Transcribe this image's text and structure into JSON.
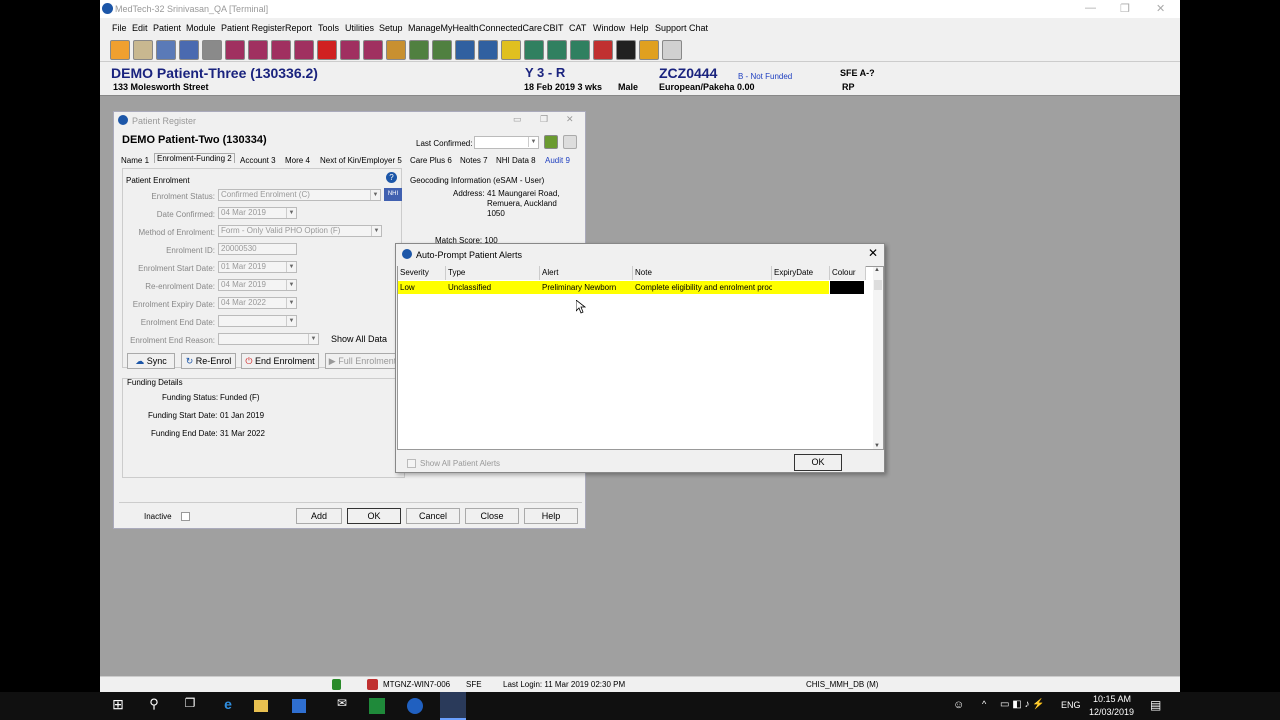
{
  "app": {
    "title": "MedTech-32  Srinivasan_QA  [Terminal]",
    "menu": [
      "File",
      "Edit",
      "Patient",
      "Module",
      "Patient Register",
      "Report",
      "Tools",
      "Utilities",
      "Setup",
      "ManageMyHealth",
      "ConnectedCare",
      "CBIT",
      "CAT",
      "Window",
      "Help",
      "Support Chat"
    ]
  },
  "banner": {
    "patient_name": "DEMO Patient-Three (130336.2)",
    "address": "133 Molesworth Street",
    "age": "Y 3 - R",
    "dob": "18 Feb 2019 3 wks",
    "gender": "Male",
    "nhi": "ZCZ0444",
    "funding": "B - Not Funded",
    "ethnicity": "European/Pakeha 0.00",
    "sfe": "SFE A-?",
    "rp": "RP"
  },
  "patient_register": {
    "title": "Patient Register",
    "patient": "DEMO Patient-Two (130334)",
    "last_confirmed_label": "Last Confirmed:",
    "tabs": [
      "Name 1",
      "Enrolment-Funding 2",
      "Account 3",
      "More 4",
      "Next of Kin/Employer 5",
      "Care Plus 6",
      "Notes 7",
      "NHI Data 8",
      "Audit 9"
    ],
    "enrolment_group": "Patient Enrolment",
    "fields": [
      {
        "label": "Enrolment Status:",
        "value": "Confirmed Enrolment (C)"
      },
      {
        "label": "Date Confirmed:",
        "value": "04 Mar 2019"
      },
      {
        "label": "Method of Enrolment:",
        "value": "Form - Only Valid PHO Option (F)"
      },
      {
        "label": "Enrolment ID:",
        "value": "20000530"
      },
      {
        "label": "Enrolment Start Date:",
        "value": "01 Mar 2019"
      },
      {
        "label": "Re-enrolment Date:",
        "value": "04 Mar 2019"
      },
      {
        "label": "Enrolment Expiry Date:",
        "value": "04 Mar 2022"
      },
      {
        "label": "Enrolment End Date:",
        "value": ""
      },
      {
        "label": "Enrolment End Reason:",
        "value": ""
      }
    ],
    "nhi_button": "NHI",
    "show_all_data": "Show All Data",
    "geocoding_title": "Geocoding Information (eSAM - User)",
    "address_label": "Address:",
    "address_lines": [
      "41 Maungarei Road,",
      "Remuera, Auckland",
      "1050"
    ],
    "match_score": "Match Score: 100",
    "action_buttons": {
      "sync": "Sync",
      "reenrol": "Re-Enrol",
      "end": "End Enrolment",
      "full": "Full Enrolment"
    },
    "funding_group": "Funding Details",
    "funding": [
      {
        "label": "Funding Status:",
        "value": "Funded (F)"
      },
      {
        "label": "Funding Start Date:",
        "value": "01 Jan 2019"
      },
      {
        "label": "Funding End Date:",
        "value": "31 Mar 2022"
      }
    ],
    "inactive_label": "Inactive",
    "buttons": {
      "add": "Add",
      "ok": "OK",
      "cancel": "Cancel",
      "close": "Close",
      "help": "Help"
    }
  },
  "alerts": {
    "title": "Auto-Prompt Patient Alerts",
    "columns": [
      "Severity",
      "Type",
      "Alert",
      "Note",
      "ExpiryDate",
      "Colour"
    ],
    "rows": [
      {
        "severity": "Low",
        "type": "Unclassified",
        "alert": "Preliminary Newborn",
        "note": "Complete eligibility and enrolment proce",
        "expiry": "",
        "colour": "#000000"
      }
    ],
    "show_all_label": "Show All Patient Alerts",
    "ok": "OK",
    "highlight_color": "#ffff00"
  },
  "statusbar": {
    "machine": "MTGNZ-WIN7-006",
    "sfe": "SFE",
    "last_login": "Last Login: 11 Mar 2019 02:30 PM",
    "db": "CHIS_MMH_DB (M)"
  },
  "taskbar": {
    "time": "10:15 AM",
    "date": "12/03/2019",
    "lang": "ENG"
  }
}
